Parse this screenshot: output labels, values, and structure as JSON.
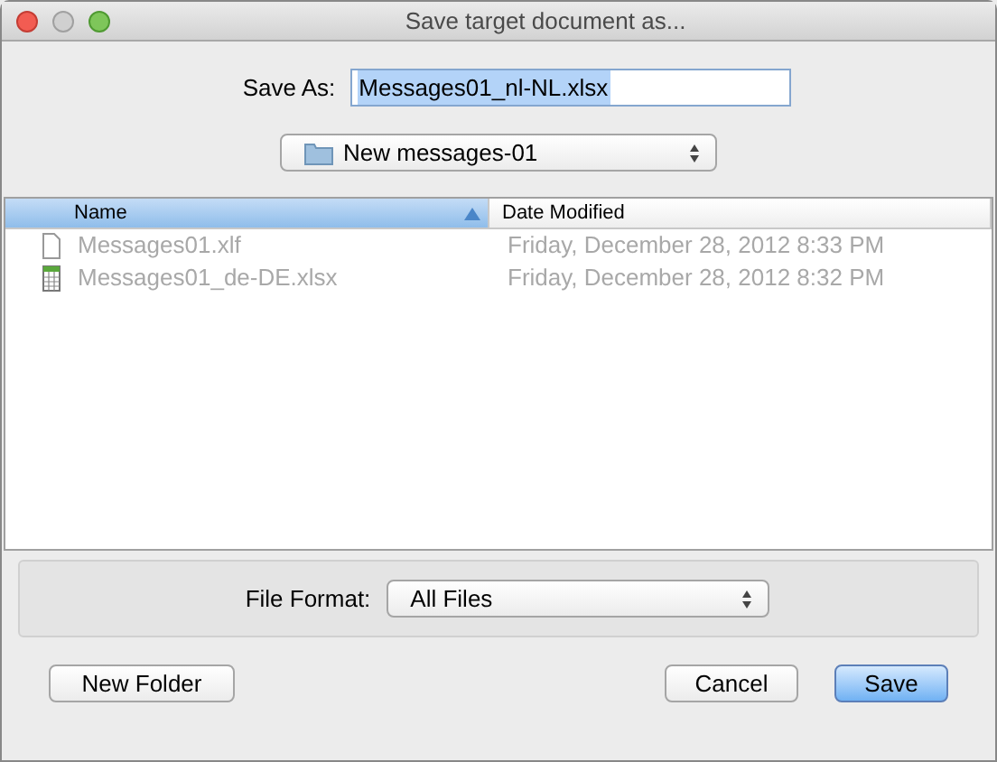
{
  "window": {
    "title": "Save target document as..."
  },
  "save_as": {
    "label": "Save As:",
    "value": "Messages01_nl-NL.xlsx"
  },
  "location": {
    "value": "New messages-01"
  },
  "columns": [
    {
      "label": "Name",
      "selected": true
    },
    {
      "label": "Date Modified",
      "selected": false
    }
  ],
  "files": [
    {
      "kind": "document",
      "name": "Messages01.xlf",
      "date": "Friday, December 28, 2012 8:33 PM",
      "disabled": true
    },
    {
      "kind": "spreadsheet",
      "name": "Messages01_de-DE.xlsx",
      "date": "Friday, December 28, 2012 8:32 PM",
      "disabled": true
    }
  ],
  "file_format": {
    "label": "File Format:",
    "value": "All Files"
  },
  "buttons": [
    {
      "label": "New Folder",
      "default": false
    },
    {
      "label": "Cancel",
      "default": false
    },
    {
      "label": "Save",
      "default": true
    }
  ]
}
